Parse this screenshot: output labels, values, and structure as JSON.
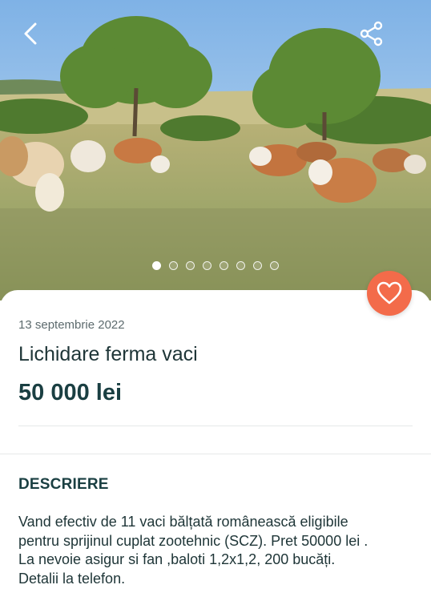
{
  "ad": {
    "date": "13 septembrie 2022",
    "title": "Lichidare ferma vaci",
    "price": "50 000 lei"
  },
  "gallery": {
    "image_count": 8,
    "active_index": 0
  },
  "icons": {
    "back": "back-arrow-icon",
    "share": "share-icon",
    "favorite": "heart-icon"
  },
  "colors": {
    "accent": "#f36b4a",
    "heading": "#1a3f42"
  },
  "description": {
    "heading": "DESCRIERE",
    "lines": [
      "Vand efectiv de 11 vaci bălțată românească eligibile",
      "pentru sprijinul cuplat zootehnic (SCZ). Pret 50000 lei .",
      "La nevoie asigur si fan ,baloti 1,2x1,2, 200 bucăți.",
      "Detalii la telefon."
    ]
  }
}
